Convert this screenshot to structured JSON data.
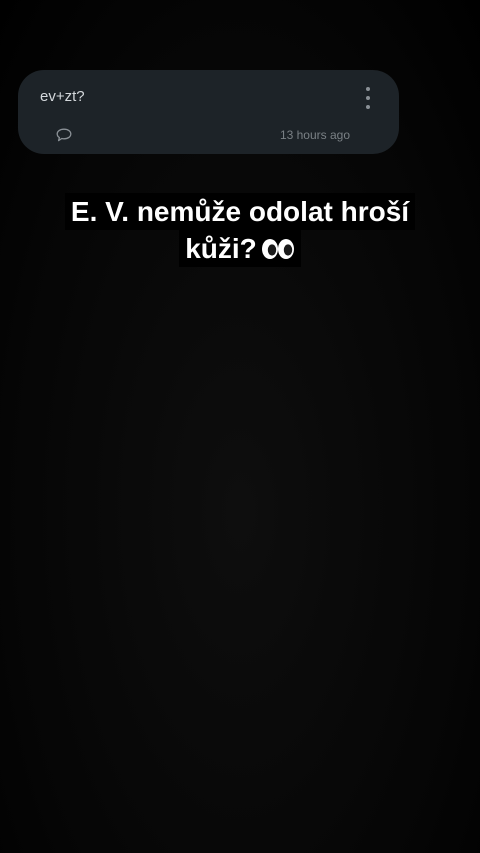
{
  "card": {
    "text": "ev+zt?",
    "timestamp": "13 hours ago",
    "icons": {
      "reply": "comment-bubble-icon",
      "more": "more-vertical-icon"
    }
  },
  "caption": {
    "line1": "E. V. nemůže odolat hroší",
    "line2": "kůži?",
    "emoji": "eyes-emoji"
  },
  "colors": {
    "background": "#000000",
    "card": "#1d2328",
    "caption_text": "#ffffff",
    "muted_text": "#7a8085"
  }
}
